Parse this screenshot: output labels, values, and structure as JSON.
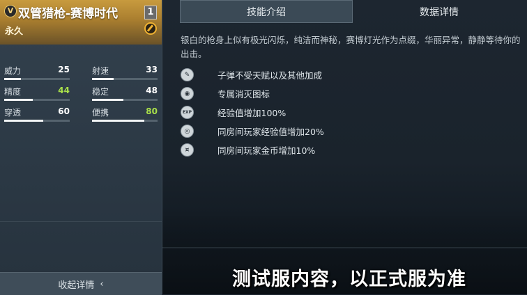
{
  "weapon": {
    "tier_badge": "V",
    "name": "双管猎枪-赛博时代",
    "level": "1",
    "duration": "永久"
  },
  "stats": [
    {
      "label": "威力",
      "value": "25",
      "fill": 0.25,
      "highlight": false
    },
    {
      "label": "射速",
      "value": "33",
      "fill": 0.33,
      "highlight": false
    },
    {
      "label": "精度",
      "value": "44",
      "fill": 0.44,
      "highlight": true
    },
    {
      "label": "稳定",
      "value": "48",
      "fill": 0.48,
      "highlight": false
    },
    {
      "label": "穿透",
      "value": "60",
      "fill": 0.6,
      "highlight": false
    },
    {
      "label": "便携",
      "value": "80",
      "fill": 0.8,
      "highlight": true
    }
  ],
  "collapse_button": {
    "label": "收起详情"
  },
  "tabs": [
    {
      "label": "技能介绍",
      "active": true
    },
    {
      "label": "数据详情",
      "active": false
    }
  ],
  "description": "银白的枪身上似有极光闪烁，纯洁而神秘，赛博灯光作为点缀，华丽异常，静静等待你的出击。",
  "features": [
    {
      "icon": "bullet-icon",
      "glyph": "✎",
      "text": "子弹不受天赋以及其他加成"
    },
    {
      "icon": "kill-icon",
      "glyph": "◉",
      "text": "专属消灭图标"
    },
    {
      "icon": "exp-icon",
      "glyph": "EXP",
      "text": "经验值增加100%"
    },
    {
      "icon": "room-exp-icon",
      "glyph": "◎",
      "text": "同房间玩家经验值增加20%"
    },
    {
      "icon": "room-coin-icon",
      "glyph": "¤",
      "text": "同房间玩家金币增加10%"
    }
  ],
  "watermark": "测试服内容，以正式服为准",
  "colors": {
    "header_gold": "#c89b3e",
    "highlight_green": "#a9e04a",
    "panel_bg": "#2b3844"
  }
}
